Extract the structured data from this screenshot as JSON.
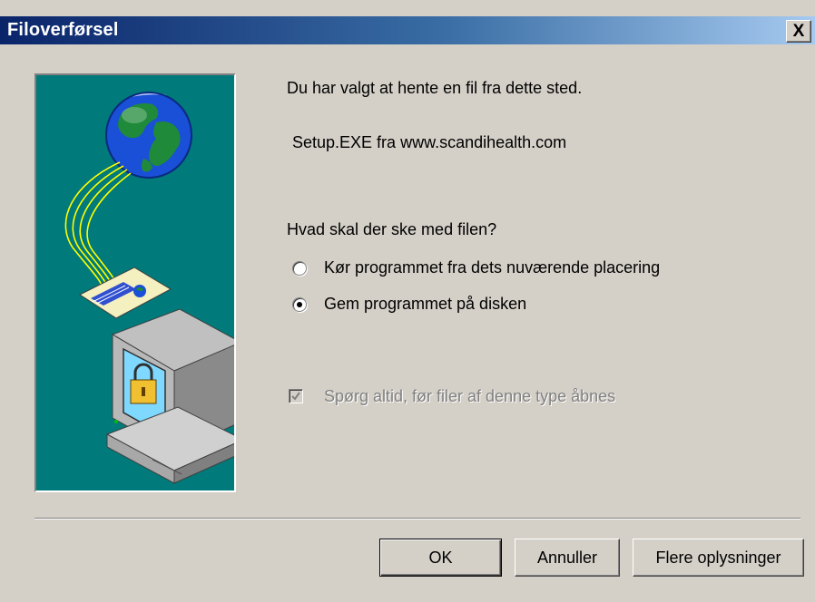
{
  "window": {
    "title": "Filoverførsel",
    "close_symbol": "X"
  },
  "message": {
    "line1": "Du har valgt at hente en fil fra dette sted.",
    "file": "Setup.EXE fra www.scandihealth.com",
    "question": "Hvad skal der ske med filen?"
  },
  "options": [
    {
      "label": "Kør programmet fra dets nuværende placering",
      "selected": false
    },
    {
      "label": "Gem programmet på disken",
      "selected": true
    }
  ],
  "checkbox": {
    "label": "Spørg altid, før filer af denne type åbnes",
    "checked": true,
    "disabled": true
  },
  "buttons": {
    "ok": "OK",
    "cancel": "Annuller",
    "more": "Flere oplysninger"
  },
  "illustration": {
    "icon": "download-globe-computer-lock-icon",
    "background": "#007a7a"
  }
}
